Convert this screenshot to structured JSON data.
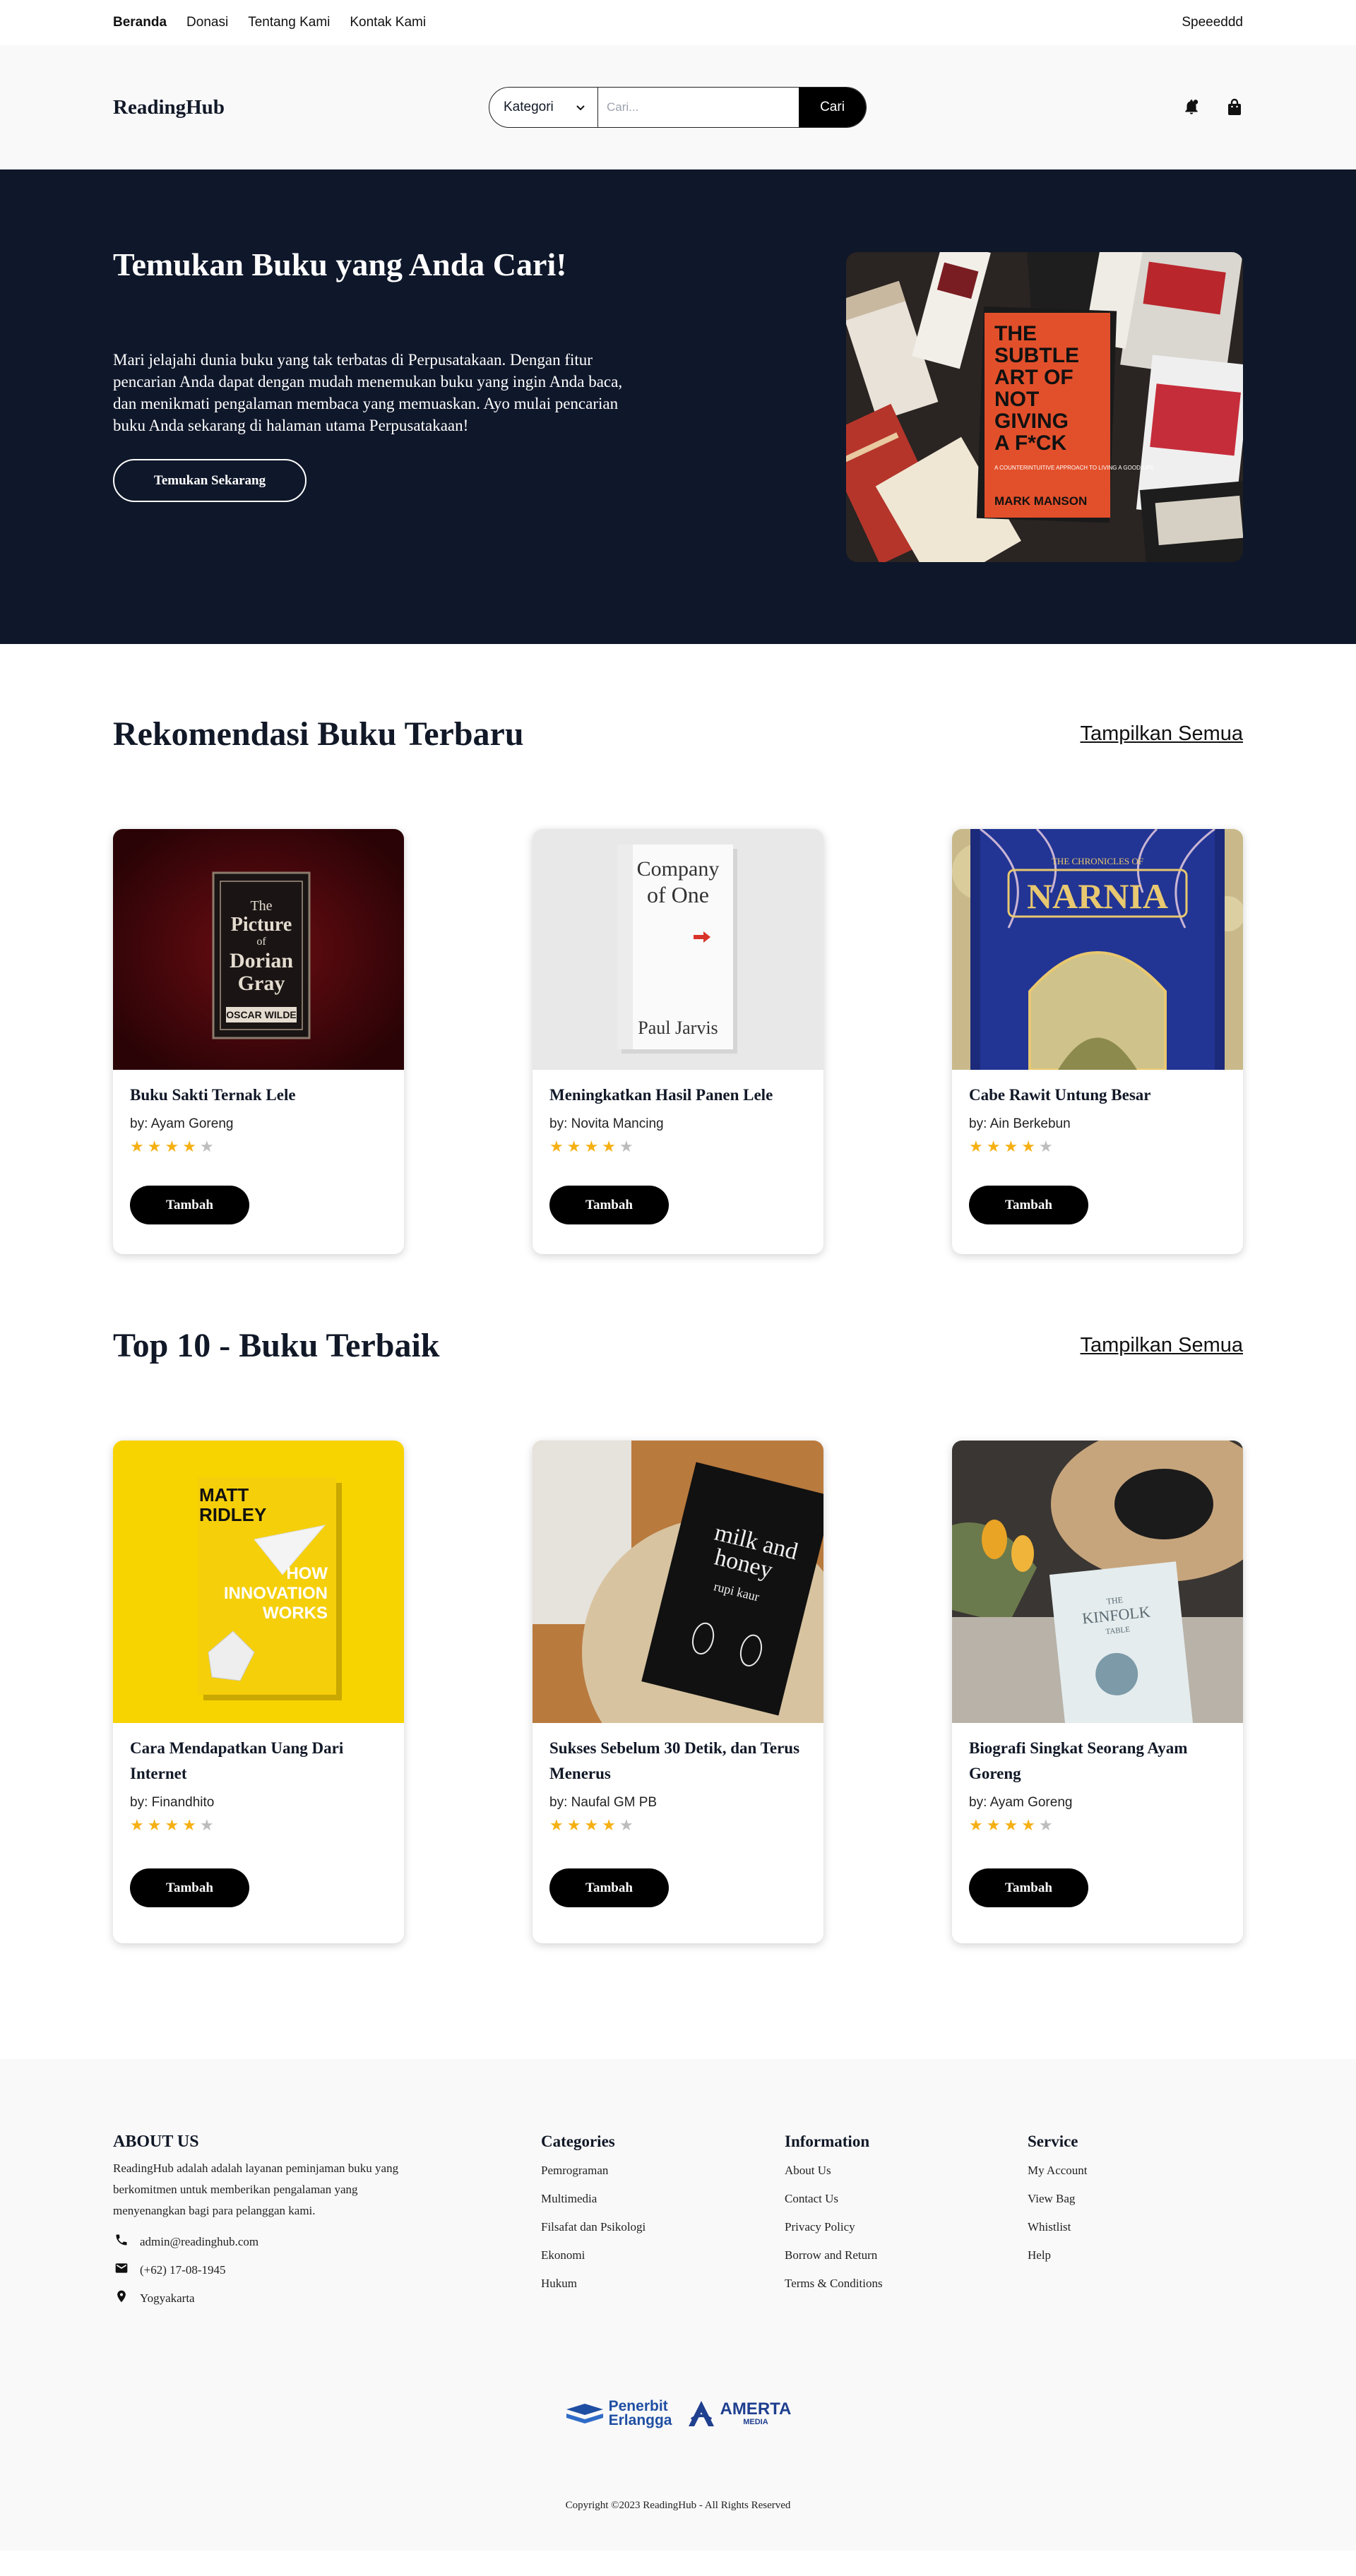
{
  "topnav": {
    "links": [
      {
        "label": "Beranda",
        "active": true
      },
      {
        "label": "Donasi",
        "active": false
      },
      {
        "label": "Tentang Kami",
        "active": false
      },
      {
        "label": "Kontak Kami",
        "active": false
      }
    ],
    "username": "Speeeddd"
  },
  "header": {
    "logo": "ReadingHub",
    "category_label": "Kategori",
    "search_placeholder": "Cari...",
    "search_button": "Cari",
    "icons": [
      "bell-icon",
      "bag-icon"
    ]
  },
  "hero": {
    "title": "Temukan Buku yang Anda Cari!",
    "description": "Mari jelajahi dunia buku yang tak terbatas di Perpusatakaan. Dengan fitur pencarian Anda dapat dengan mudah menemukan buku yang ingin Anda baca, dan menikmati pengalaman membaca yang memuaskan. Ayo mulai pencarian buku Anda sekarang di halaman utama Perpusatakaan!",
    "button": "Temukan Sekarang",
    "book_text": {
      "title_lines": [
        "THE",
        "SUBTLE",
        "ART OF",
        "NOT",
        "GIVING",
        "A F*CK"
      ],
      "subtitle": "A COUNTERINTUITIVE APPROACH TO LIVING A GOOD LIFE",
      "author": "MARK MANSON"
    }
  },
  "recommend": {
    "title": "Rekomendasi Buku Terbaru",
    "see_all": "Tampilkan Semua",
    "books": [
      {
        "title": "Buku Sakti Ternak Lele",
        "author": "by: Ayam Goreng",
        "rating": 4,
        "button": "Tambah",
        "cover_lines": [
          "The",
          "Picture",
          "of",
          "Dorian",
          "Gray",
          "OSCAR WILDE"
        ]
      },
      {
        "title": "Meningkatkan Hasil Panen Lele",
        "author": "by: Novita Mancing",
        "rating": 4,
        "button": "Tambah",
        "cover_lines": [
          "Company",
          "of One",
          "Paul Jarvis"
        ]
      },
      {
        "title": "Cabe Rawit Untung Besar",
        "author": "by: Ain Berkebun",
        "rating": 4,
        "button": "Tambah",
        "cover_lines": [
          "THE CHRONICLES OF",
          "NARNIA"
        ]
      }
    ]
  },
  "top10": {
    "title": "Top 10 - Buku Terbaik",
    "see_all": "Tampilkan Semua",
    "books": [
      {
        "title": "Cara Mendapatkan Uang Dari Internet",
        "author": "by: Finandhito",
        "rating": 4,
        "button": "Tambah",
        "cover_lines": [
          "MATT",
          "RIDLEY",
          "HOW",
          "INNOVATION",
          "WORKS"
        ]
      },
      {
        "title": "Sukses Sebelum 30 Detik, dan Terus Menerus",
        "author": "by: Naufal GM PB",
        "rating": 4,
        "button": "Tambah",
        "cover_lines": [
          "milk and",
          "honey",
          "rupi kaur"
        ]
      },
      {
        "title": "Biografi Singkat Seorang Ayam Goreng",
        "author": "by: Ayam Goreng",
        "rating": 4,
        "button": "Tambah",
        "cover_lines": [
          "THE",
          "KINFOLK",
          "TABLE"
        ]
      }
    ]
  },
  "footer": {
    "about_title": "ABOUT US",
    "about_text": "ReadingHub adalah adalah layanan peminjaman buku yang berkomitmen untuk memberikan pengalaman yang menyenangkan bagi para pelanggan kami.",
    "email": "admin@readinghub.com",
    "phone": "(+62) 17-08-1945",
    "location": "Yogyakarta",
    "categories_title": "Categories",
    "categories": [
      "Pemrograman",
      "Multimedia",
      "Filsafat dan Psikologi",
      "Ekonomi",
      "Hukum"
    ],
    "information_title": "Information",
    "information": [
      "About Us",
      "Contact Us",
      "Privacy Policy",
      "Borrow and Return",
      "Terms & Conditions"
    ],
    "service_title": "Service",
    "service": [
      "My Account",
      "View Bag",
      "Whistlist",
      "Help"
    ],
    "partners": [
      {
        "name_lines": [
          "Penerbit",
          "Erlangga"
        ],
        "color": "#1f4fa3"
      },
      {
        "name_lines": [
          "AMERTA",
          "MEDIA"
        ],
        "color": "#1f3f8f"
      }
    ],
    "copyright": "Copyright ©2023 ReadingHub - All Rights Reserved"
  },
  "colors": {
    "hero_bg": "#0f172a",
    "star": "#f5b014",
    "star_off": "#bdbdbd",
    "button": "#000000"
  }
}
